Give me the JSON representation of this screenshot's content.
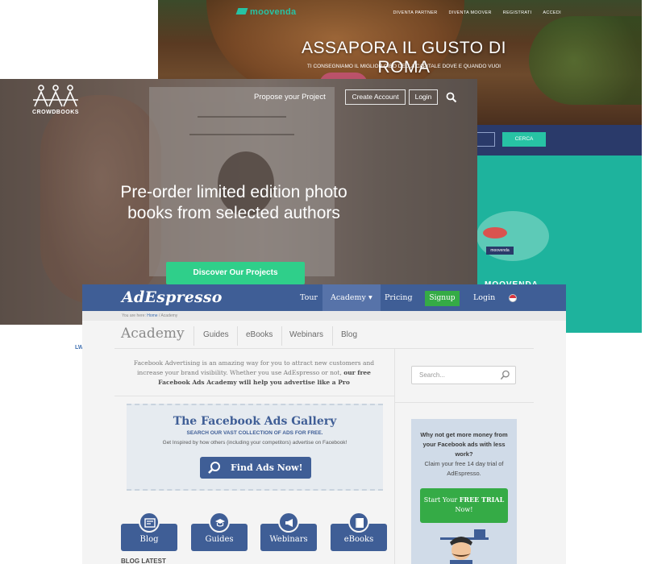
{
  "moovenda": {
    "logo": "moovenda",
    "nav": [
      "DIVENTA PARTNER",
      "DIVENTA MOOVER",
      "REGISTRATI",
      "ACCEDI"
    ],
    "title": "ASSAPORA IL GUSTO DI ROMA",
    "subtitle": "TI CONSEGNIAMO IL MIGLIOR CIBO DELLA CAPITALE DOVE E QUANDO VUOI",
    "search_button": "CERCA",
    "badge": "moovenda",
    "lower_word": "MOOVENDA",
    "colors": {
      "teal": "#1eb39d",
      "navy": "#2a3a6a",
      "accent": "#27c3a4"
    }
  },
  "left_fragment": "LW",
  "crowdbooks": {
    "logo_text": "CROWDBOOKS",
    "propose": "Propose your Project",
    "create_account": "Create Account",
    "login": "Login",
    "search_icon": "search-icon",
    "headline": "Pre-order limited edition photo books from selected authors",
    "cta": "Discover Our Projects",
    "colors": {
      "cta": "#2fcf8a"
    }
  },
  "adespresso": {
    "logo": "AdEspresso",
    "nav": {
      "tour": "Tour",
      "academy": "Academy ▾",
      "pricing": "Pricing",
      "signup": "Signup",
      "login": "Login"
    },
    "breadcrumb_prefix": "You are here: ",
    "breadcrumb_home": "Home",
    "breadcrumb_rest": " / Academy",
    "section_title": "Academy",
    "subnav": [
      "Guides",
      "eBooks",
      "Webinars",
      "Blog"
    ],
    "intro_plain": "Facebook Advertising is an amazing way for you to attract new customers and increase your brand visibility. Whether you use AdEspresso or not, ",
    "intro_bold": "our free Facebook Ads Academy will help you advertise like a Pro",
    "search_placeholder": "Search...",
    "gallery": {
      "title": "The Facebook Ads Gallery",
      "subtitle": "SEARCH OUR VAST COLLECTION OF ADS FOR FREE.",
      "description": "Get Inspired by how others (including your competitors) advertise on Facebook!",
      "button": "Find Ads Now!"
    },
    "categories": [
      "Blog",
      "Guides",
      "Webinars",
      "eBooks"
    ],
    "bottom_text": "BLOG LATEST",
    "promo": {
      "bold": "Why not get more money from your Facebook ads with less work?",
      "text": "Claim your free 14 day trial of AdEspresso.",
      "button_prefix": "Start Your ",
      "button_bold": "FREE TRIAL",
      "button_suffix": " Now!"
    },
    "colors": {
      "brand": "#3f5e96",
      "green": "#35ab46",
      "background": "#f4f4f4"
    }
  }
}
